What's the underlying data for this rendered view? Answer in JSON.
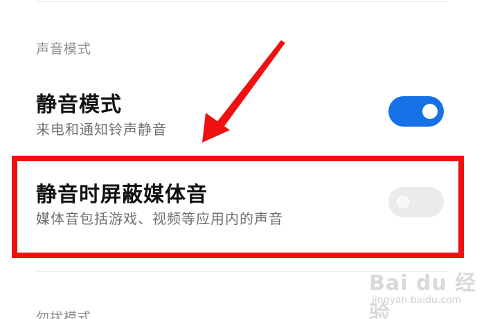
{
  "sound_mode": {
    "header": "声音模式",
    "silent_mode": {
      "title": "静音模式",
      "subtitle": "来电和通知铃声静音",
      "enabled": true
    },
    "mute_media": {
      "title": "静音时屏蔽媒体音",
      "subtitle": "媒体音包括游戏、视频等应用内的声音",
      "enabled": false
    }
  },
  "dnd_header": "勿扰模式",
  "colors": {
    "toggle_on": "#1670e6",
    "toggle_off": "#ebebeb",
    "highlight": "#ee1111"
  },
  "watermark": {
    "logo": "Bai du 经验",
    "url": "jingyan.baidu.com"
  }
}
